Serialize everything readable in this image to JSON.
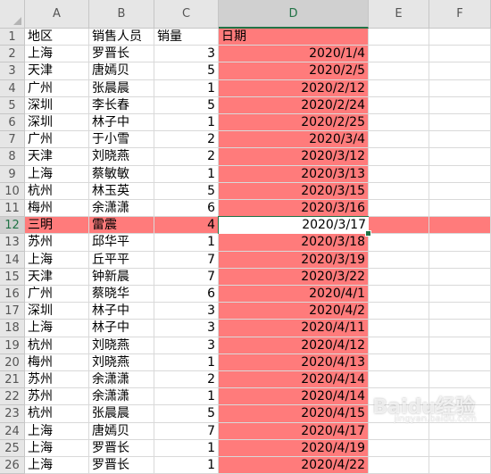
{
  "columns": [
    "A",
    "B",
    "C",
    "D",
    "E",
    "F"
  ],
  "active_column": "D",
  "active_row": 12,
  "highlight_color": "#ff7b7b",
  "selection_color": "#217346",
  "rows": [
    {
      "n": 1,
      "a": "地区",
      "b": "销售人员",
      "c": "销量",
      "d": "日期",
      "header": true
    },
    {
      "n": 2,
      "a": "上海",
      "b": "罗晋长",
      "c": "3",
      "d": "2020/1/4"
    },
    {
      "n": 3,
      "a": "天津",
      "b": "唐嫣贝",
      "c": "5",
      "d": "2020/2/5"
    },
    {
      "n": 4,
      "a": "广州",
      "b": "张晨晨",
      "c": "1",
      "d": "2020/2/12"
    },
    {
      "n": 5,
      "a": "深圳",
      "b": "李长春",
      "c": "5",
      "d": "2020/2/24"
    },
    {
      "n": 6,
      "a": "深圳",
      "b": "林子中",
      "c": "1",
      "d": "2020/2/25"
    },
    {
      "n": 7,
      "a": "广州",
      "b": "于小雪",
      "c": "2",
      "d": "2020/3/4"
    },
    {
      "n": 8,
      "a": "天津",
      "b": "刘晓燕",
      "c": "2",
      "d": "2020/3/12"
    },
    {
      "n": 9,
      "a": "上海",
      "b": "蔡敏敏",
      "c": "1",
      "d": "2020/3/13"
    },
    {
      "n": 10,
      "a": "杭州",
      "b": "林玉英",
      "c": "5",
      "d": "2020/3/15"
    },
    {
      "n": 11,
      "a": "梅州",
      "b": "余潇潇",
      "c": "6",
      "d": "2020/3/16"
    },
    {
      "n": 12,
      "a": "三明",
      "b": "雷震",
      "c": "4",
      "d": "2020/3/17"
    },
    {
      "n": 13,
      "a": "苏州",
      "b": "邱华平",
      "c": "1",
      "d": "2020/3/18"
    },
    {
      "n": 14,
      "a": "上海",
      "b": "丘平平",
      "c": "7",
      "d": "2020/3/19"
    },
    {
      "n": 15,
      "a": "天津",
      "b": "钟新晨",
      "c": "7",
      "d": "2020/3/22"
    },
    {
      "n": 16,
      "a": "广州",
      "b": "蔡晓华",
      "c": "6",
      "d": "2020/4/1"
    },
    {
      "n": 17,
      "a": "深圳",
      "b": "林子中",
      "c": "3",
      "d": "2020/4/2"
    },
    {
      "n": 18,
      "a": "上海",
      "b": "林子中",
      "c": "3",
      "d": "2020/4/11"
    },
    {
      "n": 19,
      "a": "杭州",
      "b": "刘晓燕",
      "c": "3",
      "d": "2020/4/12"
    },
    {
      "n": 20,
      "a": "梅州",
      "b": "刘晓燕",
      "c": "1",
      "d": "2020/4/13"
    },
    {
      "n": 21,
      "a": "苏州",
      "b": "余潇潇",
      "c": "2",
      "d": "2020/4/14"
    },
    {
      "n": 22,
      "a": "苏州",
      "b": "余潇潇",
      "c": "1",
      "d": "2020/4/14"
    },
    {
      "n": 23,
      "a": "杭州",
      "b": "张晨晨",
      "c": "5",
      "d": "2020/4/15"
    },
    {
      "n": 24,
      "a": "上海",
      "b": "唐嫣贝",
      "c": "7",
      "d": "2020/4/17"
    },
    {
      "n": 25,
      "a": "上海",
      "b": "罗晋长",
      "c": "1",
      "d": "2020/4/19"
    },
    {
      "n": 26,
      "a": "上海",
      "b": "罗晋长",
      "c": "1",
      "d": "2020/4/22"
    }
  ],
  "watermark": {
    "text": "Baidu经验",
    "sub": "jingyan.baidu.com"
  }
}
